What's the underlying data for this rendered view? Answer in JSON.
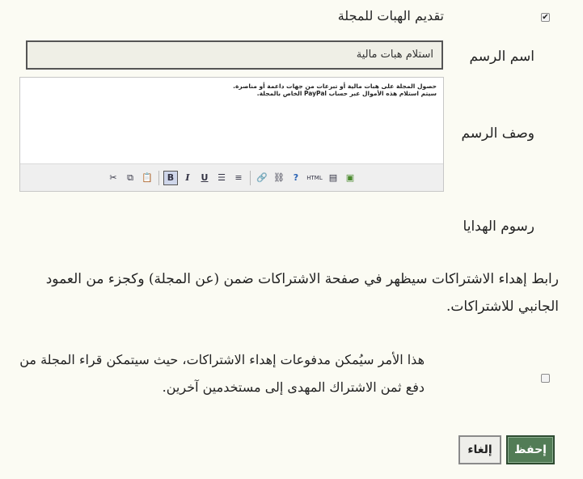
{
  "settings": {
    "enable_gifts_label": "تقديم الهبات للمجلة",
    "enable_gifts_checked": true,
    "fee_name_label": "اسم الرسم",
    "fee_name_value": "استلام هبات مالية",
    "fee_description_label": "وصف الرسم",
    "fee_description_lines": [
      "حصول المجلة على هبات مالية أو تبرعات من جهات داعمة أو مناصرة.",
      "سيتم استلام هذه الأموال عبر حساب PayPal الخاص بالمجلة."
    ],
    "gift_fees_label": "رسوم الهدايا",
    "gift_link_description": "رابط إهداء الاشتراكات سيظهر في صفحة الاشتراكات ضمن (عن المجلة) وكجزء من العمود الجانبي للاشتراكات.",
    "enable_gift_payments_text": "هذا الأمر سيُمكن مدفوعات إهداء الاشتراكات، حيث سيتمكن قراء المجلة من دفع ثمن الاشتراك المهدى إلى مستخدمين آخرين.",
    "enable_gift_payments_checked": false
  },
  "toolbar": {
    "buttons": [
      "cut-icon",
      "copy-icon",
      "paste-icon",
      "bold-icon",
      "italic-icon",
      "underline-icon",
      "bullet-list-icon",
      "numbered-list-icon",
      "link-icon",
      "unlink-icon",
      "help-icon",
      "html-icon",
      "code-icon",
      "image-icon"
    ]
  },
  "actions": {
    "save_label": "إحفظ",
    "cancel_label": "إلغاء"
  }
}
